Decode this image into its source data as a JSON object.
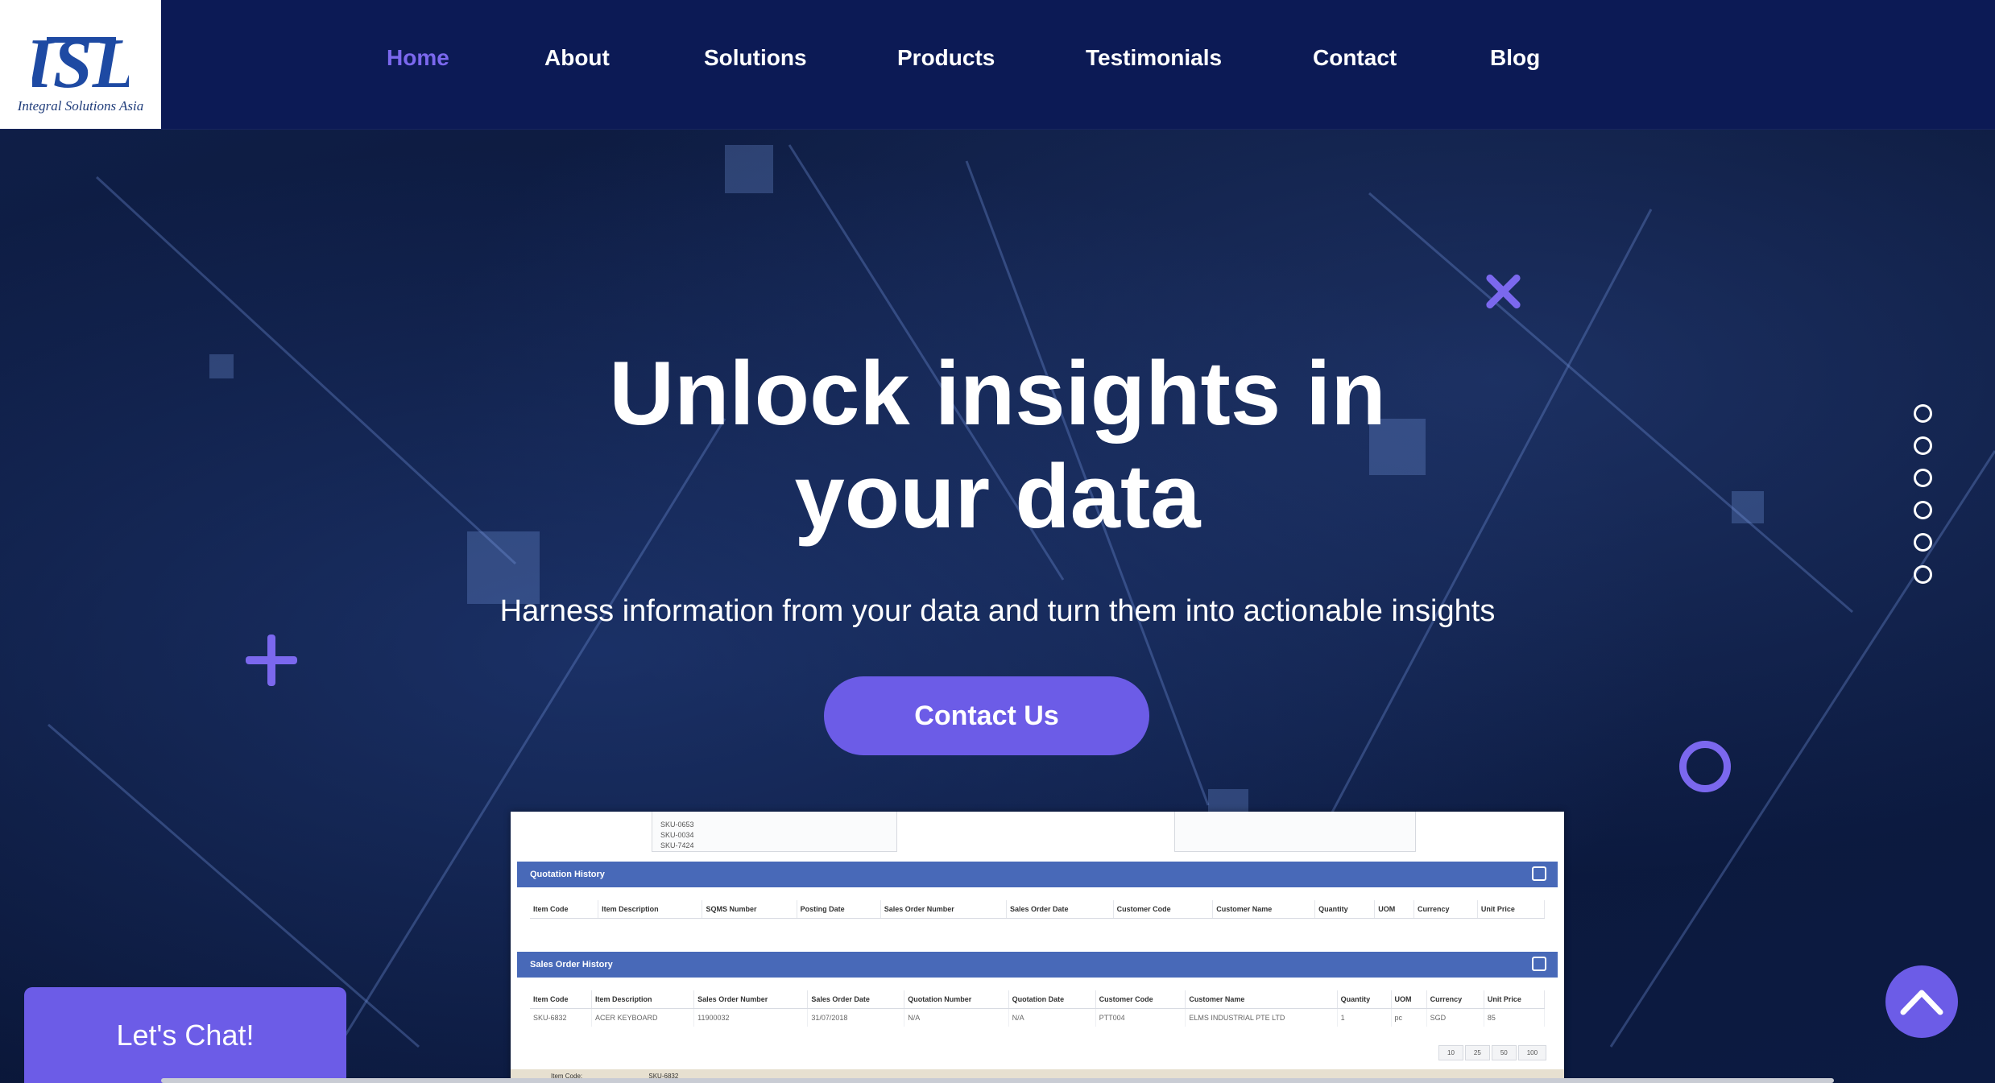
{
  "logo": {
    "monogram": "ISL",
    "tagline": "Integral Solutions Asia"
  },
  "nav": {
    "items": [
      {
        "label": "Home",
        "active": true
      },
      {
        "label": "About"
      },
      {
        "label": "Solutions"
      },
      {
        "label": "Products"
      },
      {
        "label": "Testimonials"
      },
      {
        "label": "Contact"
      },
      {
        "label": "Blog"
      }
    ]
  },
  "hero": {
    "headline_line1": "Unlock insights in",
    "headline_line2": "your data",
    "subheadline": "Harness information from your data and turn them into actionable insights",
    "cta_label": "Contact Us"
  },
  "slider": {
    "dot_count": 6
  },
  "preview": {
    "sku_list": [
      "SKU-0653",
      "SKU-0034",
      "SKU-7424"
    ],
    "quotation_title": "Quotation History",
    "quotation_columns": [
      "Item Code",
      "Item Description",
      "SQMS Number",
      "Posting Date",
      "Sales Order Number",
      "Sales Order Date",
      "Customer Code",
      "Customer Name",
      "Quantity",
      "UOM",
      "Currency",
      "Unit Price"
    ],
    "sales_title": "Sales Order History",
    "sales_columns": [
      "Item Code",
      "Item Description",
      "Sales Order Number",
      "Sales Order Date",
      "Quotation Number",
      "Quotation Date",
      "Customer Code",
      "Customer Name",
      "Quantity",
      "UOM",
      "Currency",
      "Unit Price"
    ],
    "sales_row": [
      "SKU-6832",
      "ACER KEYBOARD",
      "11900032",
      "31/07/2018",
      "N/A",
      "N/A",
      "PTT004",
      "ELMS INDUSTRIAL PTE LTD",
      "1",
      "pc",
      "SGD",
      "85"
    ],
    "pager": [
      "10",
      "25",
      "50",
      "100"
    ],
    "footer_label": "Item Code:",
    "footer_value": "SKU-6832"
  },
  "chat": {
    "label": "Let's Chat!"
  },
  "colors": {
    "accent": "#6c5ce7",
    "nav_bg": "#0c1a55",
    "nav_active": "#7b68ee",
    "hero_bg": "#0b1638",
    "preview_header": "#4869b8"
  },
  "icons": {
    "scroll_top": "chevron-up-icon",
    "x_decor": "x-shape-icon",
    "plus_decor": "plus-icon",
    "ring_decor": "ring-icon"
  }
}
